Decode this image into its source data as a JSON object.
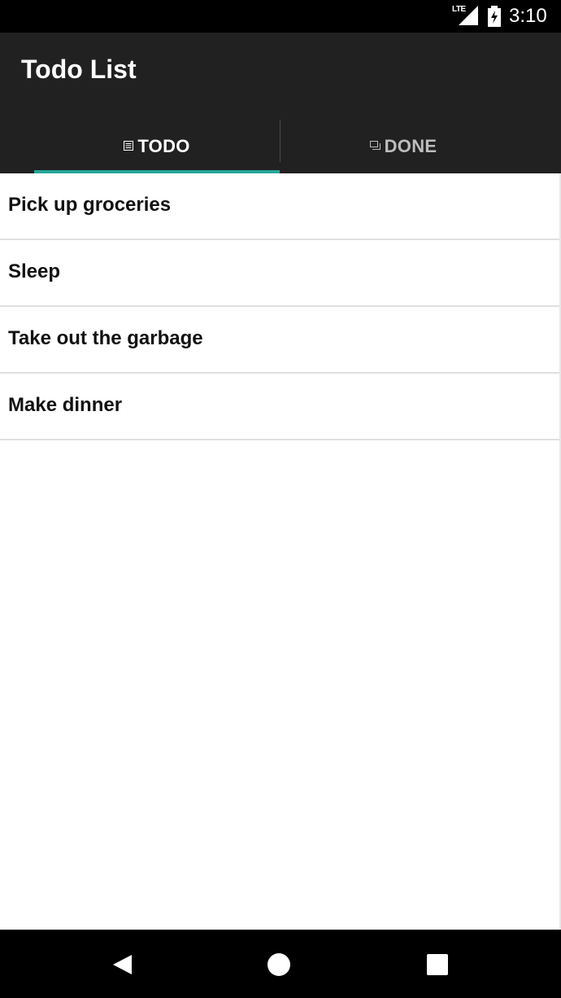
{
  "status_bar": {
    "network_label": "LTE",
    "time": "3:10",
    "icons": [
      "signal-icon",
      "battery-icon"
    ]
  },
  "app_bar": {
    "title": "Todo List",
    "tabs": [
      {
        "label": "TODO",
        "icon": "list-icon",
        "selected": true
      },
      {
        "label": "DONE",
        "icon": "stack-icon",
        "selected": false
      }
    ],
    "colors": {
      "background": "#212121",
      "indicator": "#26a69a",
      "selected_tab_text": "#ffffff",
      "unselected_tab_text": "#bdbdbd"
    }
  },
  "todo_items": [
    {
      "text": "Pick up groceries"
    },
    {
      "text": "Sleep"
    },
    {
      "text": "Take out the garbage"
    },
    {
      "text": "Make dinner"
    }
  ],
  "nav_bar": {
    "buttons": [
      "back-icon",
      "home-icon",
      "recents-icon"
    ]
  }
}
